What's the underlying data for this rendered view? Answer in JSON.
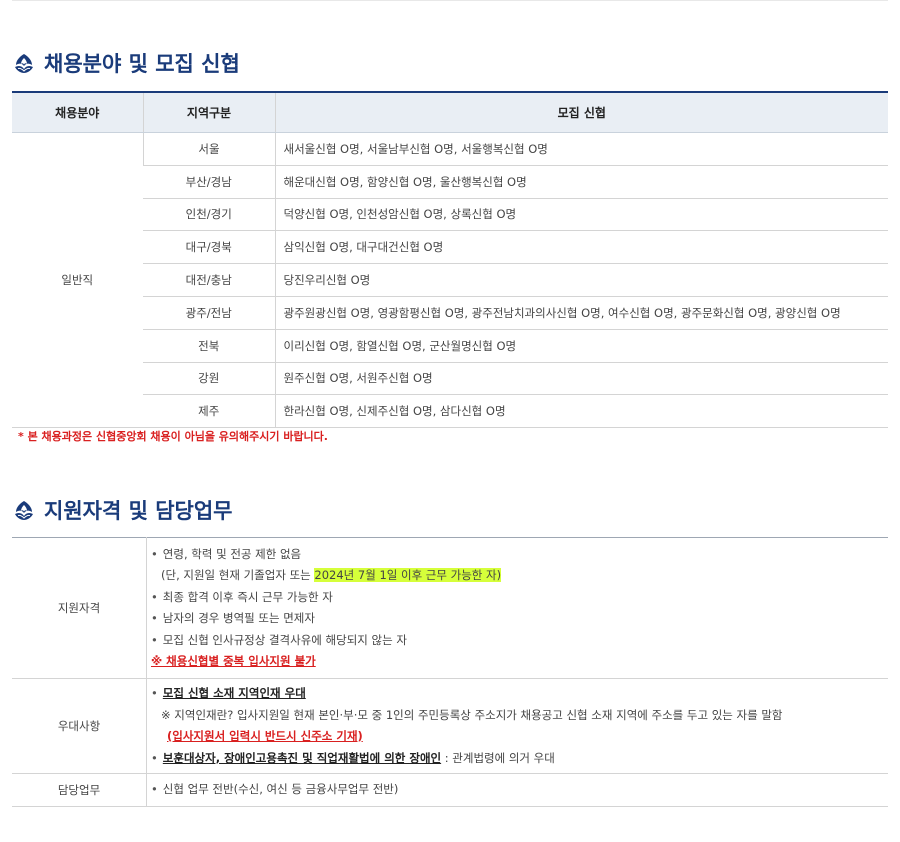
{
  "section1": {
    "title": "채용분야 및 모집 신협",
    "headers": [
      "채용분야",
      "지역구분",
      "모집 신협"
    ],
    "category": "일반직",
    "rows": [
      {
        "region": "서울",
        "branches": "새서울신협 O명, 서울남부신협 O명, 서울행복신협 O명"
      },
      {
        "region": "부산/경남",
        "branches": "해운대신협 O명, 함양신협 O명, 울산행복신협 O명"
      },
      {
        "region": "인천/경기",
        "branches": "덕양신협 O명, 인천성암신협 O명, 상록신협 O명"
      },
      {
        "region": "대구/경북",
        "branches": "삼익신협 O명, 대구대건신협 O명"
      },
      {
        "region": "대전/충남",
        "branches": "당진우리신협 O명"
      },
      {
        "region": "광주/전남",
        "branches": "광주원광신협 O명, 영광함평신협 O명, 광주전남치과의사신협 O명, 여수신협 O명, 광주문화신협 O명, 광양신협 O명"
      },
      {
        "region": "전북",
        "branches": "이리신협 O명, 함열신협 O명, 군산월명신협 O명"
      },
      {
        "region": "강원",
        "branches": "원주신협 O명, 서원주신협 O명"
      },
      {
        "region": "제주",
        "branches": "한라신협 O명, 신제주신협 O명, 삼다신협 O명"
      }
    ],
    "note": "* 본 채용과정은 신협중앙회 채용이 아님을 유의해주시기 바랍니다."
  },
  "section2": {
    "title": "지원자격 및 담당업무",
    "qualification": {
      "label": "지원자격",
      "line1": "연령, 학력 및 전공 제한 없음",
      "line2_prefix": "(단, 지원일 현재 기졸업자 또는 ",
      "line2_highlight": "2024년 7월 1일 이후 근무 가능한 자)",
      "line3": "최종 합격 이후 즉시 근무 가능한 자",
      "line4": "남자의 경우 병역필 또는 면제자",
      "line5": "모집 신협 인사규정상 결격사유에 해당되지 않는 자",
      "warning": "※ 채용신협별 중복 입사지원 불가"
    },
    "preference": {
      "label": "우대사항",
      "line1": "모집 신협 소재 지역인재 우대",
      "line2": "※ 지역인재란? 입사지원일 현재 본인·부·모 중 1인의 주민등록상 주소지가 채용공고 신협 소재 지역에 주소를 두고 있는 자를 말함",
      "line3": "(입사지원서 입력시 반드시 신주소 기재)",
      "line4_bold": "보훈대상자, 장애인고용촉진 및 직업재활법에 의한 장애인",
      "line4_rest": " : 관계법령에 의거 우대"
    },
    "duties": {
      "label": "담당업무",
      "line1": "신협 업무 전반(수신, 여신 등 금융사무업무 전반)"
    }
  },
  "colors": {
    "accent": "#1a3b7a",
    "header_bg": "#e9eef4",
    "warning": "#d92020",
    "highlight": "#d6ff3a"
  },
  "icons": {
    "title_icon": "shinhyup-logo-icon"
  }
}
